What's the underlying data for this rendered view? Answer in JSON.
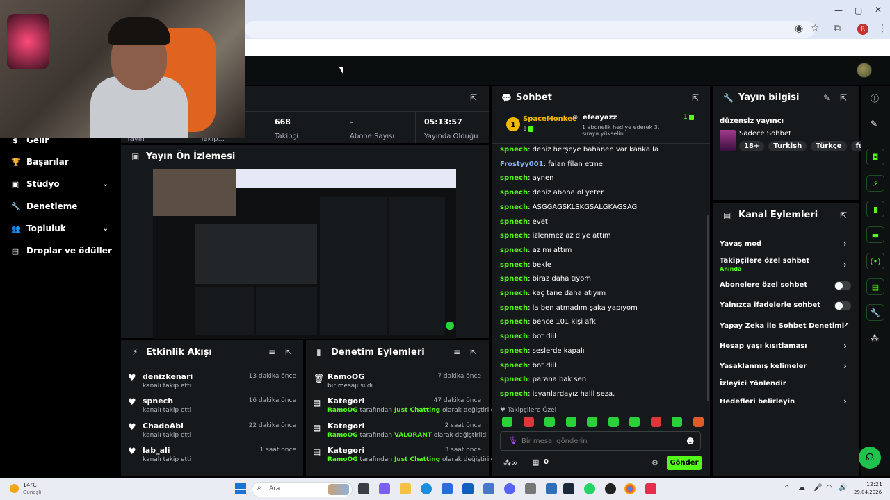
{
  "browser": {
    "window_controls": [
      "—",
      "▢",
      "✕"
    ],
    "profile_initial": "R"
  },
  "sidebar": {
    "items": [
      {
        "label": "Gelir",
        "icon": "revenue-icon"
      },
      {
        "label": "Başarılar",
        "icon": "trophy-icon"
      },
      {
        "label": "Stüdyo",
        "icon": "studio-icon"
      },
      {
        "label": "Denetleme",
        "icon": "wrench-icon"
      },
      {
        "label": "Topluluk",
        "icon": "community-icon"
      },
      {
        "label": "Droplar ve ödüller",
        "icon": "drops-icon"
      }
    ]
  },
  "stats": {
    "items": [
      {
        "value": "668",
        "label": "Takipçi"
      },
      {
        "value": "-",
        "label": "Abone Sayısı"
      },
      {
        "value": "05:13:57",
        "label": "Yayında Olduğu"
      }
    ],
    "partial_labels": [
      "Yayın",
      "Takip..."
    ]
  },
  "preview": {
    "title": "Yayın Ön İzlemesi"
  },
  "activity": {
    "title": "Etkinlik Akışı",
    "events": [
      {
        "name": "denizkenari",
        "desc": "kanalı takip etti",
        "time": "13 dakika önce"
      },
      {
        "name": "spnech",
        "desc": "kanalı takip etti",
        "time": "16 dakika önce"
      },
      {
        "name": "ChadoAbi",
        "desc": "kanalı takip etti",
        "time": "22 dakika önce"
      },
      {
        "name": "lab_ali",
        "desc": "kanalı takip etti",
        "time": "1 saat önce"
      }
    ]
  },
  "moderation": {
    "title": "Denetim Eylemleri",
    "events": [
      {
        "name": "RamoOG",
        "desc_plain": "bir mesajı sildi",
        "time": "7 dakika önce",
        "icon": "trash-icon"
      },
      {
        "name": "Kategori",
        "actor": "RamoOG",
        "mid": "tarafından",
        "value": "Just Chatting",
        "tail": "olarak değiştirildi",
        "time": "47 dakika önce",
        "icon": "category-icon"
      },
      {
        "name": "Kategori",
        "actor": "RamoOG",
        "mid": "tarafından",
        "value": "VALORANT",
        "tail": "olarak değiştirildi",
        "time": "2 saat önce",
        "icon": "category-icon"
      },
      {
        "name": "Kategori",
        "actor": "RamoOG",
        "mid": "tarafından",
        "value": "Just Chatting",
        "tail": "olarak değiştirildi",
        "time": "3 saat önce",
        "icon": "category-icon"
      }
    ]
  },
  "chat": {
    "title": "Sohbet",
    "pinned": {
      "gifter": "SpaceMonkee",
      "gifter_count": "1",
      "recipient": "efeayazz",
      "recipient_count": "1",
      "message": "1 abonelik hediye ederek 3. sıraya yükselin"
    },
    "messages": [
      {
        "user": "spnech",
        "text": "deniz herşeye bahanen var kanka la"
      },
      {
        "user": "Frostyy001",
        "text": "falan filan etme"
      },
      {
        "user": "spnech",
        "text": "aynen"
      },
      {
        "user": "spnech",
        "text": "deniz abone ol yeter"
      },
      {
        "user": "spnech",
        "text": "ASGĞAGSKLSKGSALGKAGSAG"
      },
      {
        "user": "spnech",
        "text": "evet"
      },
      {
        "user": "spnech",
        "text": "izlenmez az diye attım"
      },
      {
        "user": "spnech",
        "text": "az mı attım"
      },
      {
        "user": "spnech",
        "text": "bekle"
      },
      {
        "user": "spnech",
        "text": "biraz daha tıyom"
      },
      {
        "user": "spnech",
        "text": "kaç tane daha atıyım"
      },
      {
        "user": "spnech",
        "text": "la ben atmadım şaka yapıyom"
      },
      {
        "user": "spnech",
        "text": "bence 101 kişi afk"
      },
      {
        "user": "spnech",
        "text": "bot diil"
      },
      {
        "user": "spnech",
        "text": "seslerde kapalı"
      },
      {
        "user": "spnech",
        "text": "bot diil"
      },
      {
        "user": "spnech",
        "text": "parana bak sen"
      },
      {
        "user": "spnech",
        "text": "isyanlardayız halil seza."
      }
    ],
    "followers_only_label": "Takipçilere Özel",
    "input_placeholder": "Bir mesaj gönderin",
    "points": "0",
    "send_label": "Gönder"
  },
  "stream_info": {
    "title": "Yayın bilgisi",
    "stream_title": "düzensiz yayıncı",
    "category": "Sadece Sohbet",
    "tags": [
      "18+",
      "Turkish",
      "Türkçe",
      "funny"
    ]
  },
  "channel_actions": {
    "title": "Kanal Eylemleri",
    "items": [
      {
        "label": "Yavaş mod",
        "control": "chevron"
      },
      {
        "label": "Takipçilere özel sohbet",
        "sub": "Anında",
        "control": "chevron"
      },
      {
        "label": "Abonelere özel sohbet",
        "control": "toggle",
        "on": false
      },
      {
        "label": "Yalnızca ifadelerle sohbet",
        "control": "toggle",
        "on": false
      },
      {
        "label": "Yapay Zeka ile Sohbet Denetimi",
        "control": "external"
      },
      {
        "label": "Hesap yaşı kısıtlaması",
        "control": "chevron"
      },
      {
        "label": "Yasaklanmış kelimeler",
        "control": "chevron"
      },
      {
        "label": "İzleyici Yönlendir",
        "control": "none"
      },
      {
        "label": "Hedefleri belirleyin",
        "control": "chevron"
      }
    ]
  },
  "taskbar": {
    "weather_temp": "14°C",
    "weather_desc": "Güneşli",
    "search_placeholder": "Ara",
    "time": "12:21",
    "date": "29.04.2026"
  },
  "colors": {
    "accent": "#53fc18",
    "panel": "#16191b",
    "background": "#000000"
  }
}
